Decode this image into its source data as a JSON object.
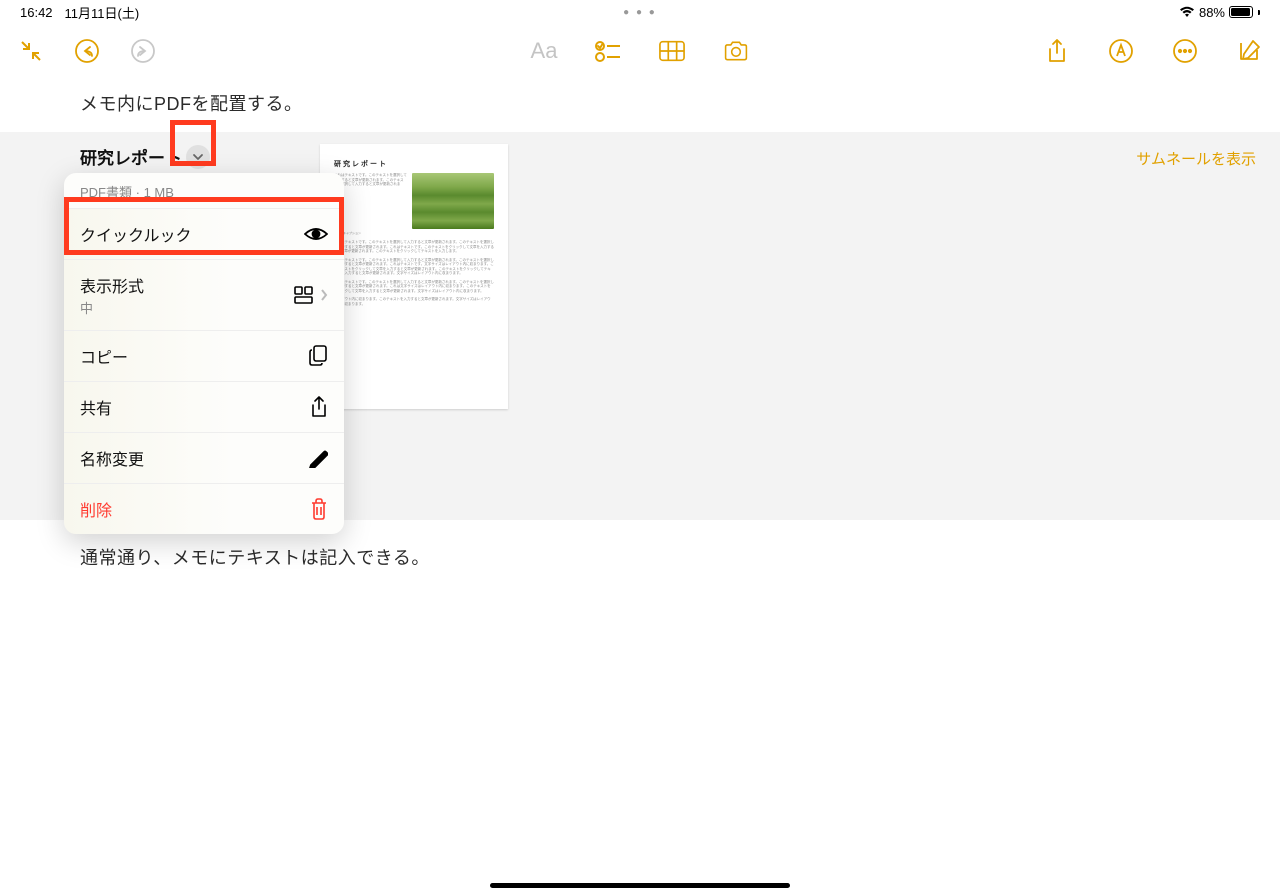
{
  "status": {
    "time": "16:42",
    "date": "11月11日(土)",
    "battery_pct": "88%"
  },
  "note": {
    "line1": "メモ内にPDFを配置する。",
    "attachment_title": "研究レポート",
    "thumbnail_link": "サムネールを表示",
    "line2": "通常通り、メモにテキストは記入できる。"
  },
  "popover": {
    "header_type": "PDF書類",
    "header_size": "1 MB",
    "quicklook": "クイックルック",
    "viewmode": "表示形式",
    "viewmode_value": "中",
    "copy": "コピー",
    "share": "共有",
    "rename": "名称変更",
    "delete": "削除"
  },
  "pdf": {
    "title": "研究レポート",
    "caption": "写真のキャプション"
  }
}
